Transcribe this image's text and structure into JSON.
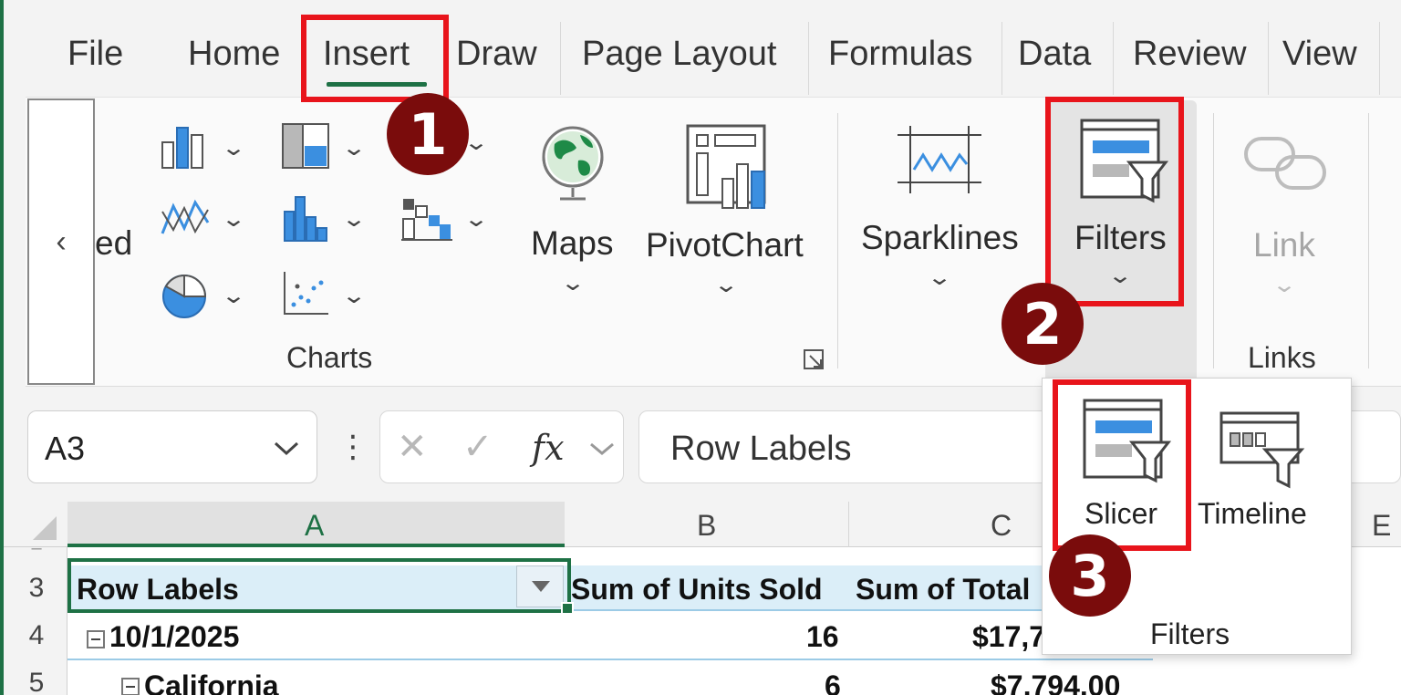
{
  "tabs": [
    "File",
    "Home",
    "Insert",
    "Draw",
    "Page Layout",
    "Formulas",
    "Data",
    "Review",
    "View"
  ],
  "ribbon": {
    "scroll_left_glyph": "‹",
    "truncated_label": "ed",
    "maps_label": "Maps",
    "pivotchart_label": "PivotChart",
    "charts_group_label": "Charts",
    "sparklines_label": "Sparklines",
    "filters_label": "Filters",
    "link_label": "Link",
    "links_group_label": "Links"
  },
  "formula_bar": {
    "name_box": "A3",
    "name_box_menu_glyph": "⋮",
    "cancel_glyph": "✕",
    "enter_glyph": "✓",
    "fx_label": "fx",
    "formula_value": "Row Labels"
  },
  "grid": {
    "columns": [
      "A",
      "B",
      "C",
      "E"
    ],
    "rows": [
      {
        "num": "3",
        "a": "Row Labels",
        "b": "Sum of Units Sold",
        "c": "Sum of Total"
      },
      {
        "num": "4",
        "a": "10/1/2025",
        "b": "16",
        "c": "$17,7"
      },
      {
        "num": "5",
        "a": "California",
        "b": "6",
        "c": "$7,794.00"
      }
    ]
  },
  "filters_dropdown": {
    "slicer_label": "Slicer",
    "timeline_label": "Timeline",
    "group_label": "Filters"
  },
  "callouts": [
    "1",
    "2",
    "3"
  ],
  "colors": {
    "excel_green": "#1e7145",
    "highlight_red": "#e8141b",
    "badge_maroon": "#7a0c0c",
    "icon_blue": "#3b8fe0",
    "pivot_header_blue": "#dbeef8"
  }
}
